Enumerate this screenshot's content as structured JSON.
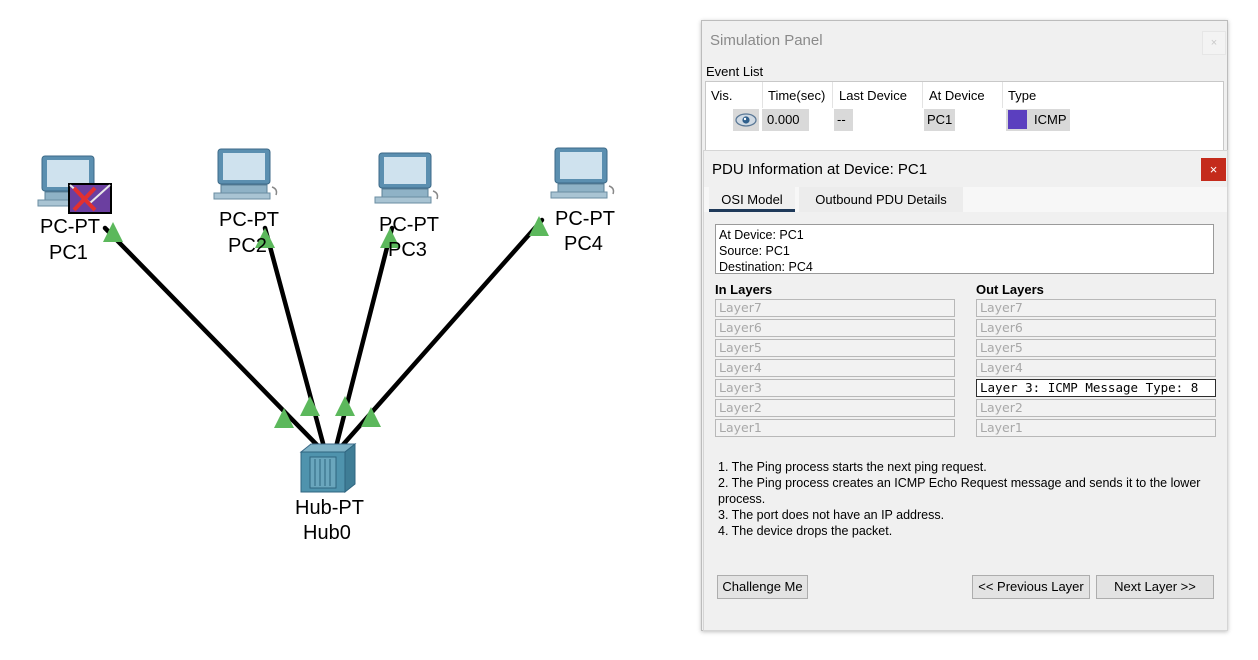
{
  "topology": {
    "devices": [
      {
        "id": "pc1",
        "type_label": "PC-PT",
        "name": "PC1"
      },
      {
        "id": "pc2",
        "type_label": "PC-PT",
        "name": "PC2"
      },
      {
        "id": "pc3",
        "type_label": "PC-PT",
        "name": "PC3"
      },
      {
        "id": "pc4",
        "type_label": "PC-PT",
        "name": "PC4"
      },
      {
        "id": "hub0",
        "type_label": "Hub-PT",
        "name": "Hub0"
      }
    ],
    "link_indicator_color": "#5cb85c",
    "link_color": "#000000"
  },
  "simulation_panel": {
    "title": "Simulation Panel",
    "close_label": "×",
    "event_list_label": "Event List",
    "columns": [
      "Vis.",
      "Time(sec)",
      "Last Device",
      "At Device",
      "Type"
    ],
    "events": [
      {
        "vis_icon": "eye-icon",
        "time": "0.000",
        "last_device": "--",
        "at_device": "PC1",
        "type": "ICMP",
        "type_color": "#5b3fbf"
      }
    ]
  },
  "pdu_info": {
    "title": "PDU Information at Device: PC1",
    "close_label": "×",
    "tabs": [
      "OSI Model",
      "Outbound PDU Details"
    ],
    "summary": [
      "At Device: PC1",
      "Source: PC1",
      "Destination: PC4"
    ],
    "in_layers_label": "In Layers",
    "out_layers_label": "Out Layers",
    "in_layers": [
      "Layer7",
      "Layer6",
      "Layer5",
      "Layer4",
      "Layer3",
      "Layer2",
      "Layer1"
    ],
    "out_layers": [
      "Layer7",
      "Layer6",
      "Layer5",
      "Layer4",
      "Layer 3: ICMP Message Type: 8",
      "Layer2",
      "Layer1"
    ],
    "steps": [
      "1. The Ping process starts the next ping request.",
      "2. The Ping process creates an ICMP Echo Request message and sends it to the lower process.",
      "3. The port does not have an IP address.",
      "4. The device drops the packet."
    ],
    "buttons": {
      "challenge": "Challenge Me",
      "previous": "<< Previous Layer",
      "next": "Next Layer >>"
    }
  }
}
